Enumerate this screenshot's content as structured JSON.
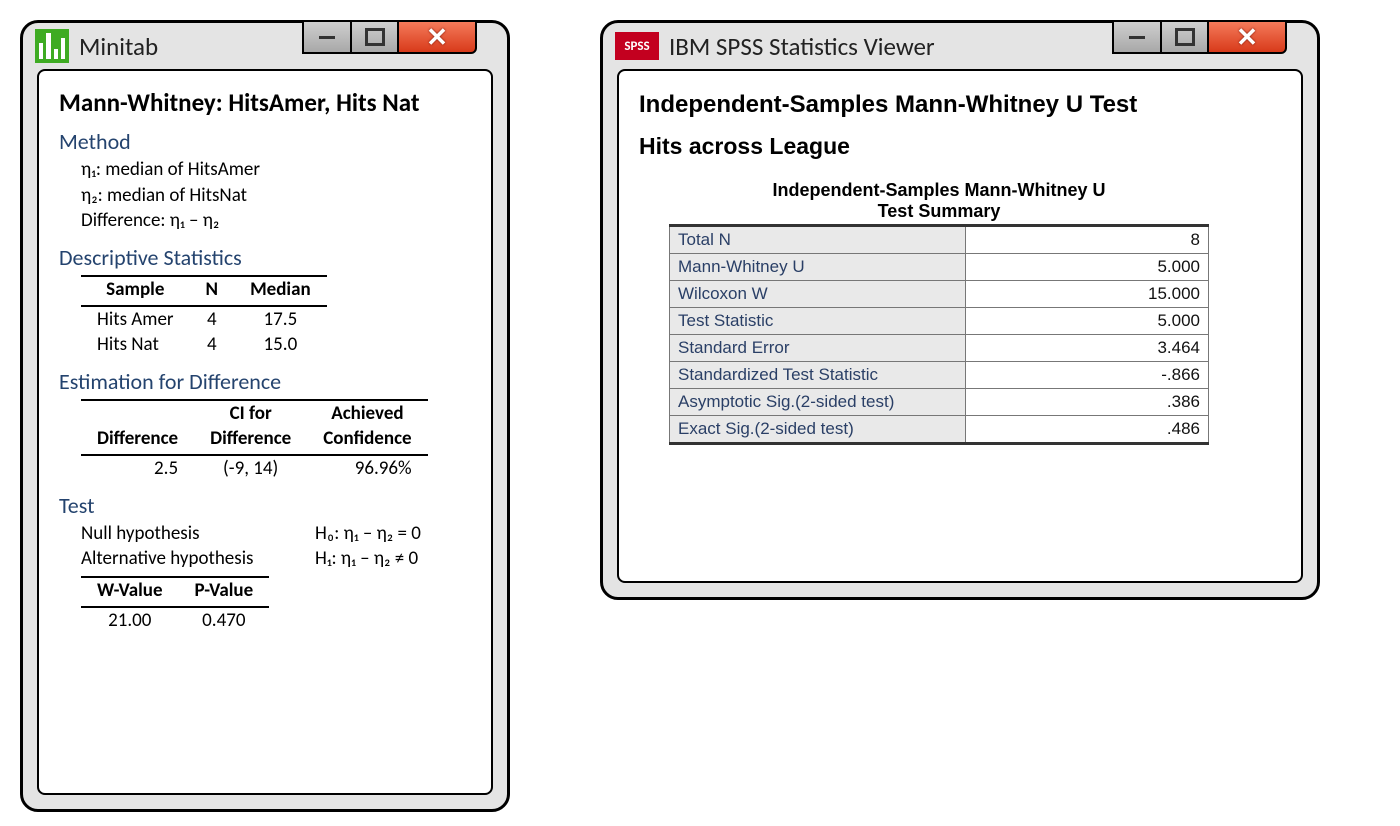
{
  "minitab": {
    "app_title": "Minitab",
    "report_title": "Mann-Whitney: HitsAmer, Hits Nat",
    "method_h": "Method",
    "method_l1": "η₁: median of HitsAmer",
    "method_l2": "η₂: median of HitsNat",
    "method_l3": "Difference: η₁ – η₂",
    "desc_h": "Descriptive Statistics",
    "desc_th1": "Sample",
    "desc_th2": "N",
    "desc_th3": "Median",
    "desc_r1c1": "Hits Amer",
    "desc_r1c2": "4",
    "desc_r1c3": "17.5",
    "desc_r2c1": "Hits Nat",
    "desc_r2c2": "4",
    "desc_r2c3": "15.0",
    "est_h": "Estimation for Difference",
    "est_th1": "Difference",
    "est_th2": "CI for\nDifference",
    "est_th2a": "CI for",
    "est_th2b": "Difference",
    "est_th3a": "Achieved",
    "est_th3b": "Confidence",
    "est_r1c1": "2.5",
    "est_r1c2": "(-9, 14)",
    "est_r1c3": "96.96%",
    "test_h": "Test",
    "test_null_l": "Null hypothesis",
    "test_null_v": "H₀: η₁ – η₂ = 0",
    "test_alt_l": "Alternative hypothesis",
    "test_alt_v": "H₁: η₁ – η₂ ≠ 0",
    "test_th1": "W-Value",
    "test_th2": "P-Value",
    "test_r1c1": "21.00",
    "test_r1c2": "0.470"
  },
  "spss": {
    "app_title": "IBM SPSS Statistics Viewer",
    "h1": "Independent-Samples Mann-Whitney U Test",
    "h2": "Hits across League",
    "tab_title_l1": "Independent-Samples Mann-Whitney U",
    "tab_title_l2": "Test Summary",
    "rows": {
      "r1l": "Total N",
      "r1v": "8",
      "r2l": "Mann-Whitney U",
      "r2v": "5.000",
      "r3l": "Wilcoxon W",
      "r3v": "15.000",
      "r4l": "Test Statistic",
      "r4v": "5.000",
      "r5l": "Standard Error",
      "r5v": "3.464",
      "r6l": "Standardized Test Statistic",
      "r6v": "-.866",
      "r7l": "Asymptotic Sig.(2-sided test)",
      "r7v": ".386",
      "r8l": "Exact Sig.(2-sided test)",
      "r8v": ".486"
    }
  }
}
